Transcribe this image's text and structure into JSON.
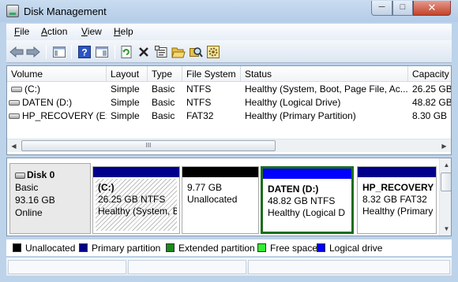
{
  "window": {
    "title": "Disk Management",
    "min_glyph": "─",
    "max_glyph": "□",
    "close_glyph": "✕"
  },
  "menu": [
    {
      "label": "File",
      "accel": "F",
      "rest": "ile"
    },
    {
      "label": "Action",
      "accel": "A",
      "rest": "ction"
    },
    {
      "label": "View",
      "accel": "V",
      "rest": "iew"
    },
    {
      "label": "Help",
      "accel": "H",
      "rest": "elp"
    }
  ],
  "toolbar": {
    "icons": [
      "back-arrow-icon",
      "forward-arrow-icon",
      "console-tree-icon",
      "help-icon",
      "show-pane-icon",
      "refresh-icon",
      "delete-icon",
      "properties-icon",
      "open-icon",
      "explore-icon",
      "settings-icon"
    ]
  },
  "volume_list": {
    "columns": [
      "Volume",
      "Layout",
      "Type",
      "File System",
      "Status",
      "Capacity"
    ],
    "rows": [
      {
        "volume": "(C:)",
        "layout": "Simple",
        "type": "Basic",
        "fs": "NTFS",
        "status": "Healthy (System, Boot, Page File, Ac...",
        "capacity": "26.25 GB"
      },
      {
        "volume": "DATEN (D:)",
        "layout": "Simple",
        "type": "Basic",
        "fs": "NTFS",
        "status": "Healthy (Logical Drive)",
        "capacity": "48.82 GB"
      },
      {
        "volume": "HP_RECOVERY (E:)",
        "layout": "Simple",
        "type": "Basic",
        "fs": "FAT32",
        "status": "Healthy (Primary Partition)",
        "capacity": "8.30 GB"
      }
    ],
    "scroll_thumb_grip": "III"
  },
  "disk": {
    "name": "Disk 0",
    "type": "Basic",
    "size": "93.16 GB",
    "state": "Online",
    "partitions": [
      {
        "name": "(C:)",
        "size_fs": "26.25 GB NTFS",
        "status": "Healthy (System, B",
        "bar_color": "#00008b",
        "hatched": true,
        "selected": false
      },
      {
        "name": "",
        "size_fs": "9.77 GB",
        "status": "Unallocated",
        "bar_color": "#000000",
        "hatched": false,
        "selected": false
      },
      {
        "name": "DATEN  (D:)",
        "size_fs": "48.82 GB NTFS",
        "status": "Healthy (Logical D",
        "bar_color": "#0000ff",
        "hatched": false,
        "selected": true
      },
      {
        "name": "HP_RECOVERY",
        "size_fs": "8.32 GB FAT32",
        "status": "Healthy (Primary",
        "bar_color": "#00008b",
        "hatched": false,
        "selected": false
      }
    ]
  },
  "legend": [
    {
      "label": "Unallocated",
      "color": "#000000"
    },
    {
      "label": "Primary partition",
      "color": "#00008b"
    },
    {
      "label": "Extended partition",
      "color": "#1a8a1a"
    },
    {
      "label": "Free space",
      "color": "#33ee33"
    },
    {
      "label": "Logical drive",
      "color": "#0000ff"
    }
  ]
}
